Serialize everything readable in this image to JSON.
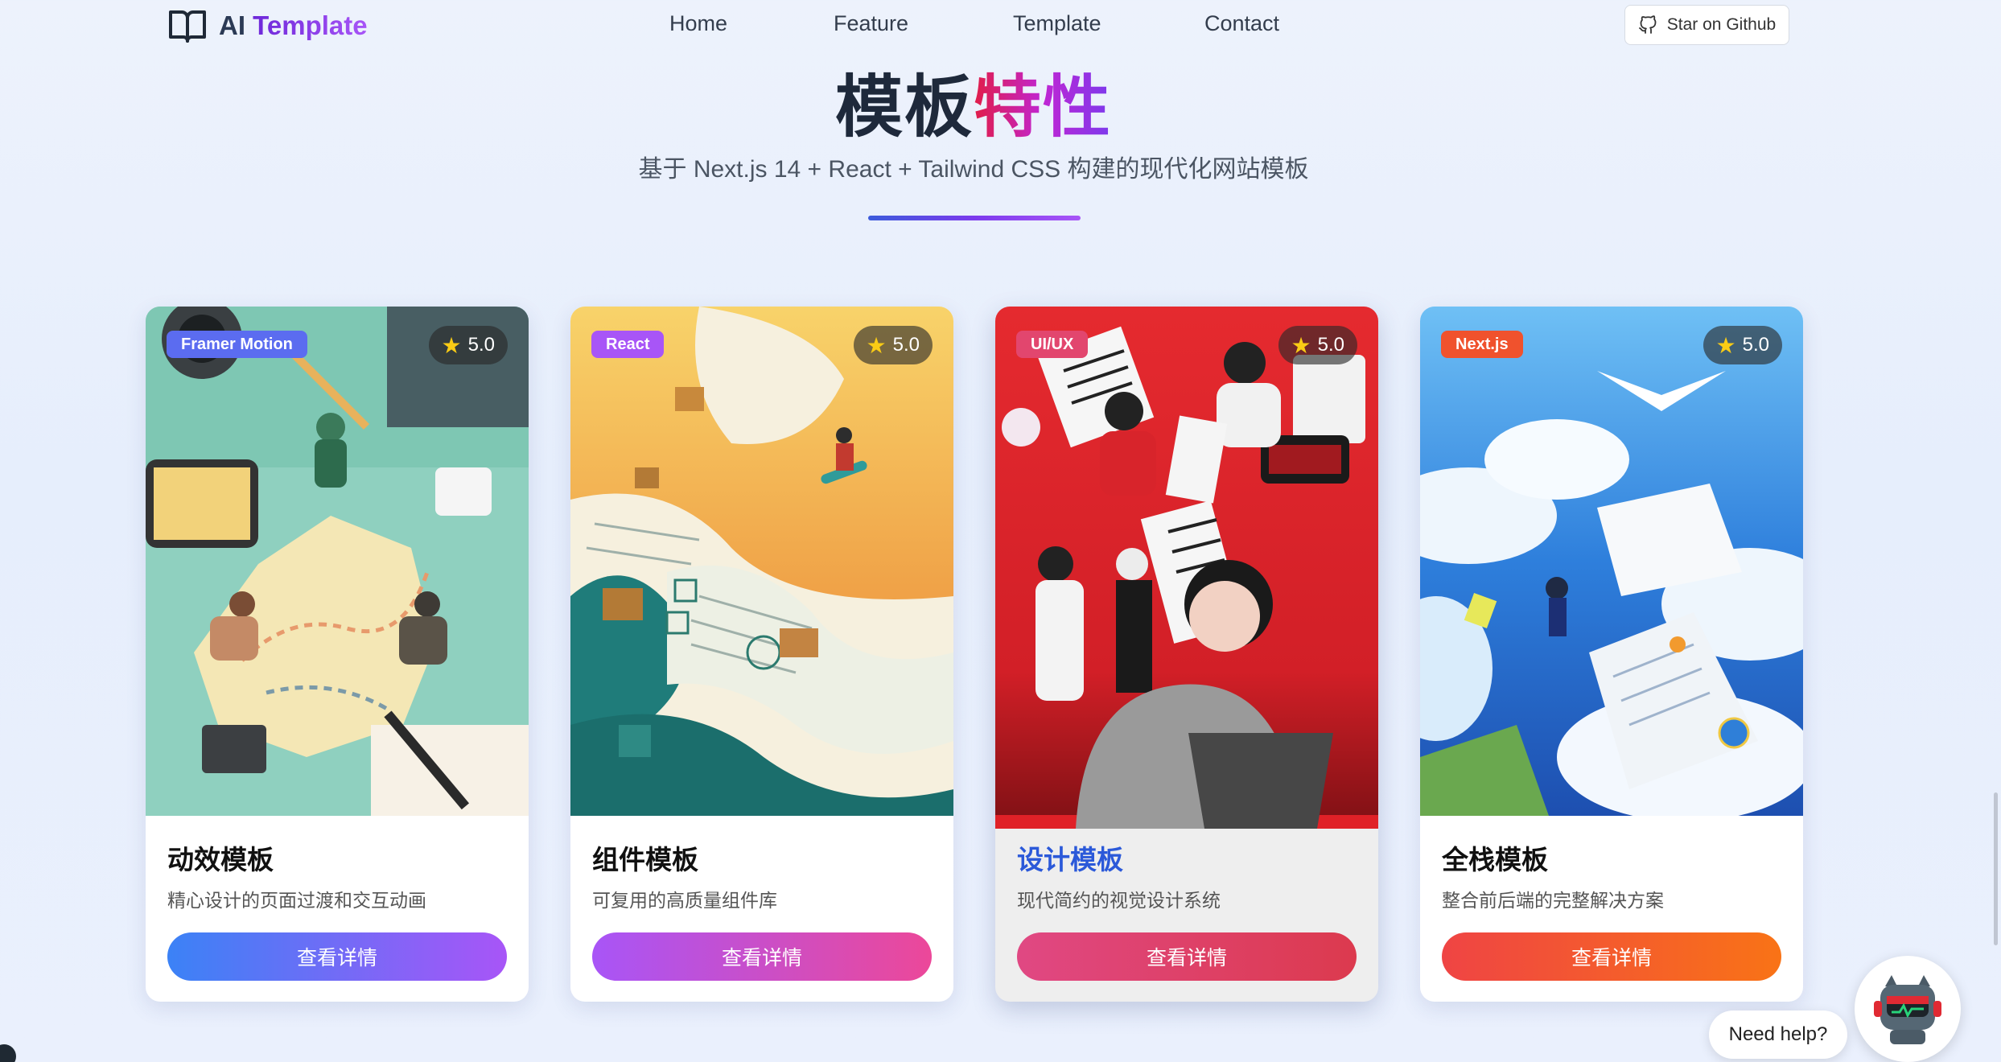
{
  "nav": {
    "logo_prefix": "AI",
    "logo_accent": "Template",
    "links": [
      "Home",
      "Feature",
      "Template",
      "Contact"
    ],
    "github_label": "Star on Github"
  },
  "hero": {
    "title_plain": "模板",
    "title_gradient": "特性",
    "subtitle": "基于 Next.js 14 + React + Tailwind CSS 构建的现代化网站模板"
  },
  "cards": [
    {
      "tag": "Framer Motion",
      "rating": "5.0",
      "title": "动效模板",
      "desc": "精心设计的页面过渡和交互动画",
      "button": "查看详情",
      "tag_color": "#5b6cf0",
      "button_gradient": [
        "#3b82f6",
        "#a855f7"
      ]
    },
    {
      "tag": "React",
      "rating": "5.0",
      "title": "组件模板",
      "desc": "可复用的高质量组件库",
      "button": "查看详情",
      "tag_color": "#a855f7",
      "button_gradient": [
        "#a855f7",
        "#ec4899"
      ]
    },
    {
      "tag": "UI/UX",
      "rating": "5.0",
      "title": "设计模板",
      "desc": "现代简约的视觉设计系统",
      "button": "查看详情",
      "tag_color": "#e2466e",
      "button_gradient": [
        "#e04883",
        "#dc3a4e"
      ]
    },
    {
      "tag": "Next.js",
      "rating": "5.0",
      "title": "全栈模板",
      "desc": "整合前后端的完整解决方案",
      "button": "查看详情",
      "tag_color": "#f0522d",
      "button_gradient": [
        "#ef4444",
        "#f97316"
      ]
    }
  ],
  "help": {
    "label": "Need help?"
  }
}
